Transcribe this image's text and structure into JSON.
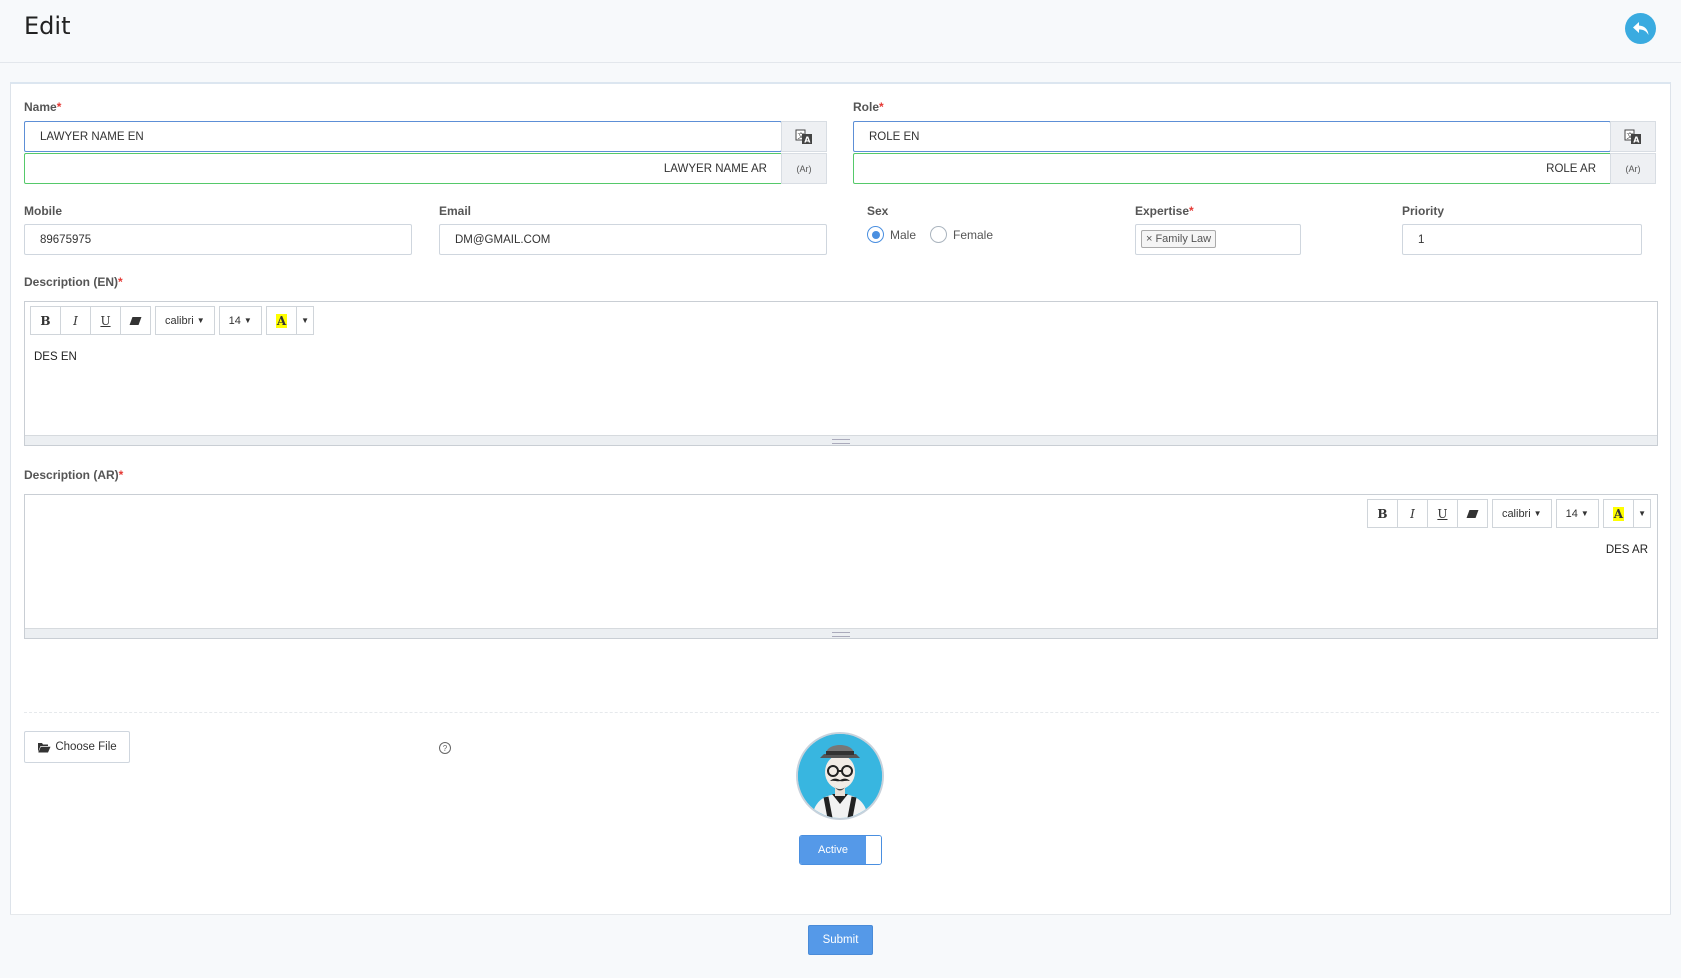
{
  "header": {
    "title": "Edit",
    "back_icon": "reply-icon"
  },
  "form": {
    "name": {
      "label": "Name",
      "required": "*",
      "value_en": "LAWYER NAME EN",
      "value_ar": "LAWYER NAME AR",
      "ar_tag": "(Ar)"
    },
    "role": {
      "label": "Role",
      "required": "*",
      "value_en": "ROLE EN",
      "value_ar": "ROLE AR",
      "ar_tag": "(Ar)"
    },
    "mobile": {
      "label": "Mobile",
      "value": "89675975"
    },
    "email": {
      "label": "Email",
      "value": "DM@GMAIL.COM"
    },
    "sex": {
      "label": "Sex",
      "options": [
        "Male",
        "Female"
      ],
      "selected": "Male"
    },
    "expertise": {
      "label": "Expertise",
      "required": "*",
      "tags": [
        "Family Law"
      ]
    },
    "priority": {
      "label": "Priority",
      "value": "1"
    },
    "description_en": {
      "label": "Description (EN)",
      "required": "*",
      "content": "DES EN"
    },
    "description_ar": {
      "label": "Description (AR)",
      "required": "*",
      "content": "DES AR"
    },
    "toolbar": {
      "bold": "B",
      "italic": "I",
      "underline": "U",
      "font": "calibri",
      "size": "14",
      "color_glyph": "A"
    },
    "file": {
      "button_label": "Choose File",
      "help": "?"
    },
    "status": {
      "label": "Active",
      "checked": true
    },
    "submit_label": "Submit"
  },
  "colors": {
    "accent": "#5599e8",
    "back_button": "#3aabe0",
    "required": "#e53935",
    "valid_border": "#55c96a"
  }
}
